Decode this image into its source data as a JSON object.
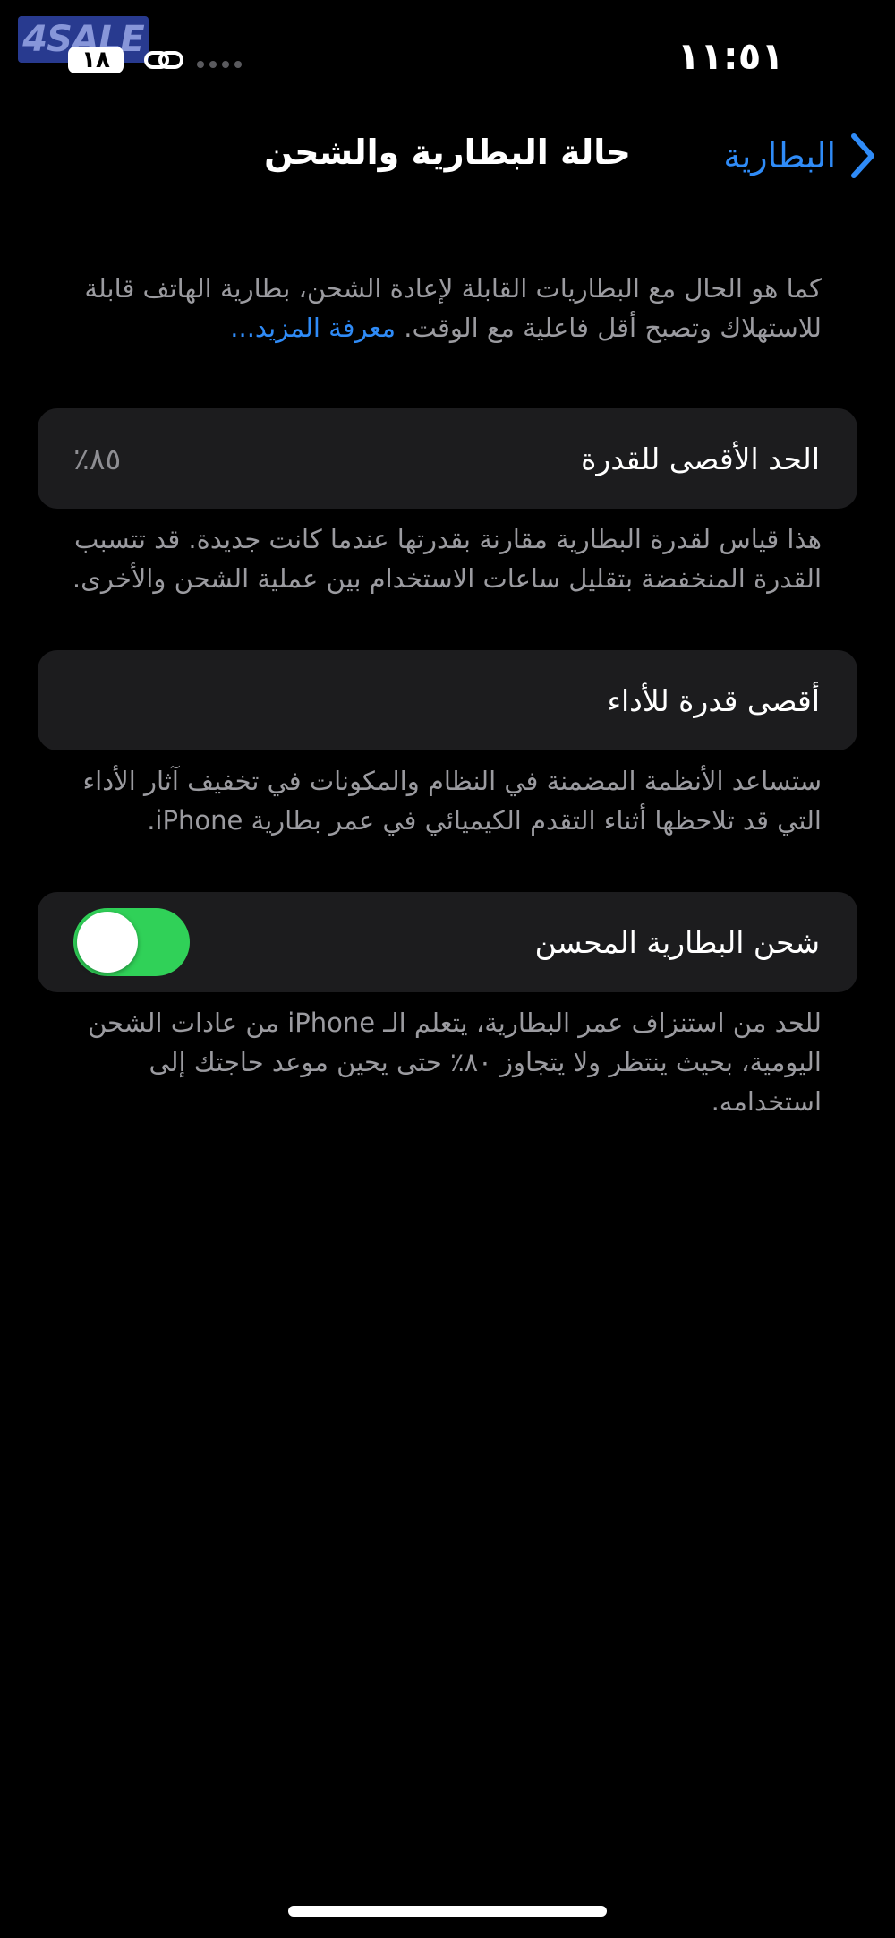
{
  "watermark": {
    "text": "4SALE"
  },
  "status_bar": {
    "time": "١١:٥١",
    "battery_level": "١٨"
  },
  "nav": {
    "back_label": "البطارية",
    "title": "حالة البطارية والشحن"
  },
  "intro": {
    "text": "كما هو الحال مع البطاريات القابلة لإعادة الشحن، بطارية الهاتف قابلة للاستهلاك وتصبح أقل فاعلية مع الوقت.",
    "learn_more": "معرفة المزيد..."
  },
  "maximum_capacity": {
    "label": "الحد الأقصى للقدرة",
    "value": "٨٥٪",
    "description": "هذا قياس لقدرة البطارية مقارنة بقدرتها عندما كانت جديدة. قد تتسبب القدرة المنخفضة بتقليل ساعات الاستخدام بين عملية الشحن والأخرى."
  },
  "peak_performance": {
    "label": "أقصى قدرة للأداء",
    "description": "ستساعد الأنظمة المضمنة في النظام والمكونات في تخفيف آثار الأداء التي قد تلاحظها أثناء التقدم الكيميائي في عمر بطارية iPhone."
  },
  "optimized_charging": {
    "label": "شحن البطارية المحسن",
    "enabled": true,
    "description": "للحد من استنزاف عمر البطارية، يتعلم الـ iPhone من عادات الشحن اليومية، بحيث ينتظر ولا يتجاوز ٨٠٪ حتى يحين موعد حاجتك إلى استخدامه."
  },
  "colors": {
    "background": "#000000",
    "card": "#1c1c1e",
    "accent": "#2f8bf7",
    "toggle_on": "#30d158",
    "secondary_text": "#9b9ba0"
  }
}
